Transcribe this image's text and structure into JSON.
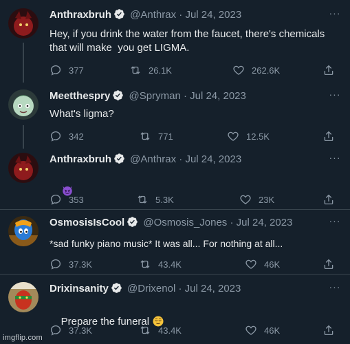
{
  "tweets": [
    {
      "name": "Anthraxbruh",
      "handle": "@Anthrax",
      "separator": "·",
      "date": "Jul 24, 2023",
      "text": "Hey, if you drink the water from the faucet, there's chemicals\nthat will make  you get LIGMA.",
      "replies": "377",
      "retweets": "26.1K",
      "likes": "262.6K"
    },
    {
      "name": "Meetthespry",
      "handle": "@Spryman",
      "separator": "·",
      "date": "Jul 24, 2023",
      "text": "What's ligma?",
      "replies": "342",
      "retweets": "771",
      "likes": "12.5K"
    },
    {
      "name": "Anthraxbruh",
      "handle": "@Anthrax",
      "separator": "·",
      "date": "Jul 24, 2023",
      "text": "",
      "emoji": "smiling-face-with-horns",
      "replies": "353",
      "retweets": "5.3K",
      "likes": "23K"
    },
    {
      "name": "OsmosisIsCool",
      "handle": "@Osmosis_Jones",
      "separator": "·",
      "date": "Jul 24, 2023",
      "text": "*sad funky piano music* It was all... For nothing at all...",
      "replies": "37.3K",
      "retweets": "43.4K",
      "likes": "46K"
    },
    {
      "name": "Drixinsanity",
      "handle": "@Drixenol",
      "separator": "·",
      "date": "Jul 24, 2023",
      "text": "Prepare the funeral ",
      "emoji": "relieved-face",
      "replies": "37.3K",
      "retweets": "43.4K",
      "likes": "46K"
    }
  ],
  "more_label": "···",
  "watermark": "imgflip.com",
  "colors": {
    "background": "#15202b",
    "text": "#e7e9ea",
    "muted": "#8b98a5",
    "verified": "#1d9bf0",
    "divider": "#38444d"
  }
}
